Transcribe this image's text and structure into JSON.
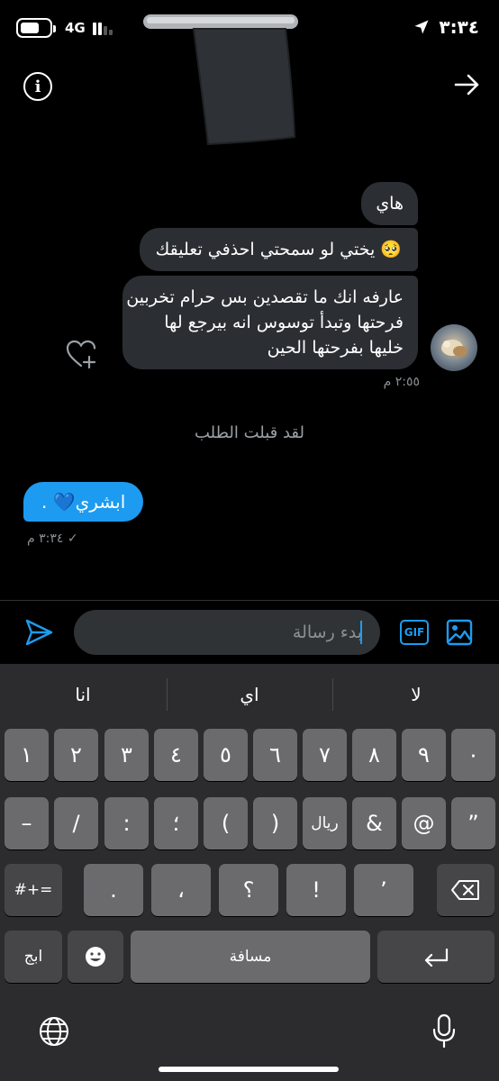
{
  "status_bar": {
    "network": "4G",
    "time": "٣:٣٤"
  },
  "messages": [
    {
      "text": "هاي"
    },
    {
      "text": "يختي لو سمحتي احذفي تعليقك 🥺"
    },
    {
      "lines": [
        "عارفه انك ما تقصدين بس حرام تخربين",
        "فرحتها وتبدأ توسوس انه بيرجع لها",
        "خليها بفرحتها الحين"
      ]
    }
  ],
  "incoming_time": "٢:٥٥ م",
  "system_note": "لقد قبلت الطلب",
  "outgoing": {
    "text": "ابشري💙 .",
    "time": "٣:٣٤ م ✓"
  },
  "composer": {
    "placeholder": "بدء رسالة",
    "gif_label": "GIF"
  },
  "keyboard": {
    "suggestions": [
      "انا",
      "اي",
      "لا"
    ],
    "row1": [
      "١",
      "٢",
      "٣",
      "٤",
      "٥",
      "٦",
      "٧",
      "٨",
      "٩",
      "٠"
    ],
    "row2": [
      "–",
      "/",
      ":",
      "؛",
      "(",
      ")",
      "ريال",
      "&",
      "@",
      "”"
    ],
    "row3_left": "#+=",
    "row3": [
      ".",
      "،",
      "؟",
      "!",
      "’"
    ],
    "lang_key": "ابج",
    "space_key": "مسافة"
  },
  "colors": {
    "accent": "#1d9bf0",
    "bubble_in": "#2b2f34",
    "keyboard_bg": "#2c2c2e",
    "key": "#6b6b6e",
    "key_dark": "#464648"
  },
  "icons": [
    "battery-icon",
    "signal-icon",
    "location-arrow-icon",
    "info-icon",
    "back-arrow-icon",
    "heart-plus-icon",
    "send-icon",
    "gif-icon",
    "image-icon",
    "smiley-icon",
    "return-icon",
    "backspace-icon",
    "globe-icon",
    "microphone-icon"
  ]
}
